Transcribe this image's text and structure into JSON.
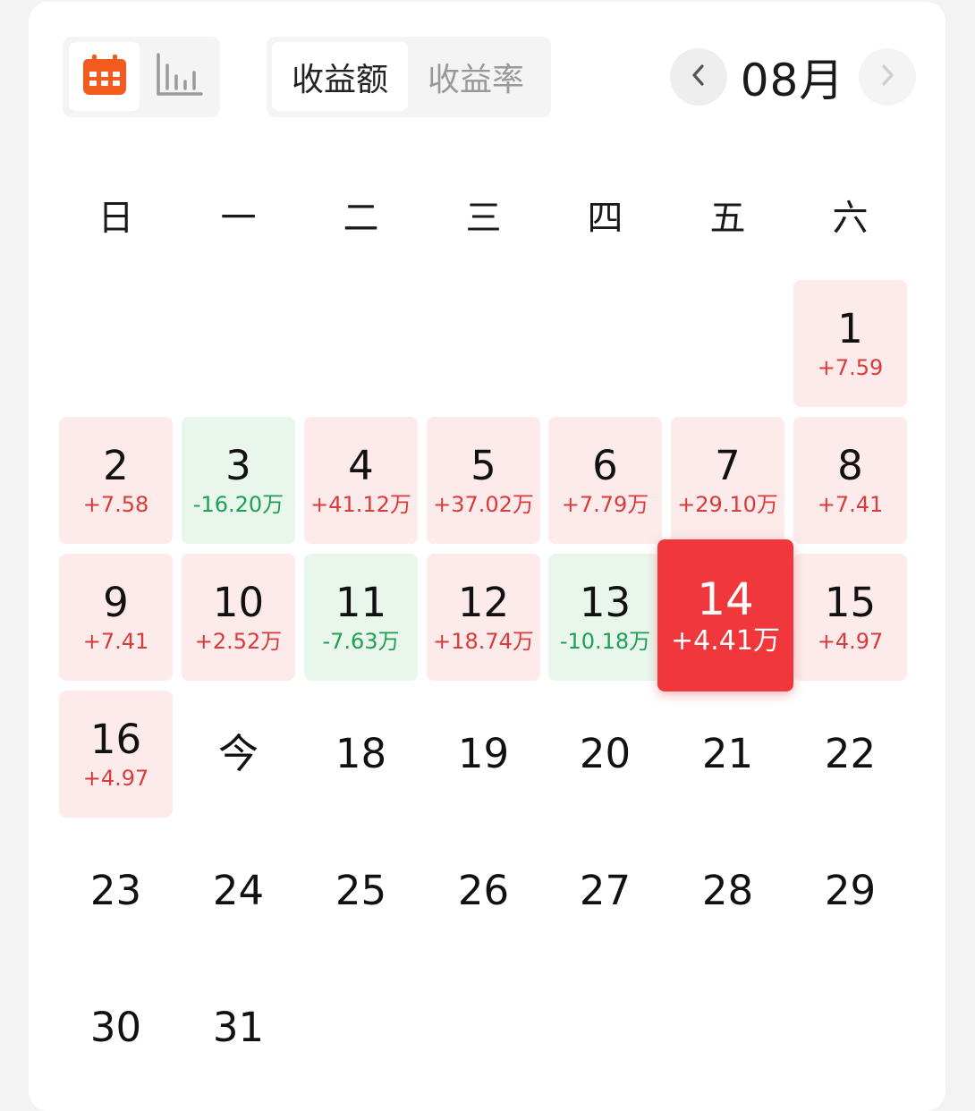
{
  "toolbar": {
    "view_modes": [
      "calendar-icon",
      "bar-chart-icon"
    ],
    "metric_tabs": [
      "收益额",
      "收益率"
    ],
    "active_metric": "收益额",
    "month": "08月",
    "prev_icon": "chevron-left-icon",
    "next_icon": "chevron-right-icon"
  },
  "colors": {
    "accent": "#f0383c",
    "positive_bg": "#fdeaea",
    "positive_text": "#d93a3a",
    "negative_bg": "#e8f6ec",
    "negative_text": "#1f9e55",
    "calendar_icon": "#f25a1e"
  },
  "weekdays": [
    "日",
    "一",
    "二",
    "三",
    "四",
    "五",
    "六"
  ],
  "days": [
    {
      "label": "1",
      "value": "+7.59",
      "type": "pos"
    },
    {
      "label": "2",
      "value": "+7.58",
      "type": "pos"
    },
    {
      "label": "3",
      "value": "-16.20万",
      "type": "neg"
    },
    {
      "label": "4",
      "value": "+41.12万",
      "type": "pos"
    },
    {
      "label": "5",
      "value": "+37.02万",
      "type": "pos"
    },
    {
      "label": "6",
      "value": "+7.79万",
      "type": "pos"
    },
    {
      "label": "7",
      "value": "+29.10万",
      "type": "pos"
    },
    {
      "label": "8",
      "value": "+7.41",
      "type": "pos"
    },
    {
      "label": "9",
      "value": "+7.41",
      "type": "pos"
    },
    {
      "label": "10",
      "value": "+2.52万",
      "type": "pos"
    },
    {
      "label": "11",
      "value": "-7.63万",
      "type": "neg"
    },
    {
      "label": "12",
      "value": "+18.74万",
      "type": "pos"
    },
    {
      "label": "13",
      "value": "-10.18万",
      "type": "neg"
    },
    {
      "label": "14",
      "value": "+4.41万",
      "type": "selected"
    },
    {
      "label": "15",
      "value": "+4.97",
      "type": "pos"
    },
    {
      "label": "16",
      "value": "+4.97",
      "type": "pos"
    },
    {
      "label": "今",
      "value": "",
      "type": "plain"
    },
    {
      "label": "18",
      "value": "",
      "type": "plain"
    },
    {
      "label": "19",
      "value": "",
      "type": "plain"
    },
    {
      "label": "20",
      "value": "",
      "type": "plain"
    },
    {
      "label": "21",
      "value": "",
      "type": "plain"
    },
    {
      "label": "22",
      "value": "",
      "type": "plain"
    },
    {
      "label": "23",
      "value": "",
      "type": "plain"
    },
    {
      "label": "24",
      "value": "",
      "type": "plain"
    },
    {
      "label": "25",
      "value": "",
      "type": "plain"
    },
    {
      "label": "26",
      "value": "",
      "type": "plain"
    },
    {
      "label": "27",
      "value": "",
      "type": "plain"
    },
    {
      "label": "28",
      "value": "",
      "type": "plain"
    },
    {
      "label": "29",
      "value": "",
      "type": "plain"
    },
    {
      "label": "30",
      "value": "",
      "type": "plain"
    },
    {
      "label": "31",
      "value": "",
      "type": "plain"
    }
  ]
}
